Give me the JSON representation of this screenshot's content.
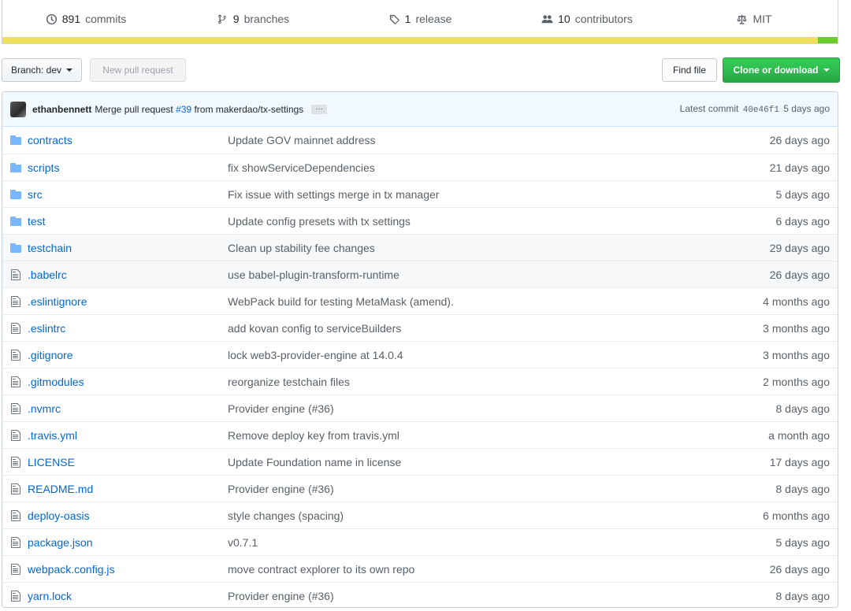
{
  "summary": {
    "commits": {
      "count": "891",
      "label": "commits",
      "icon": "history-icon"
    },
    "branches": {
      "count": "9",
      "label": "branches",
      "icon": "branch-icon"
    },
    "releases": {
      "count": "1",
      "label": "release",
      "icon": "tag-icon"
    },
    "contributors": {
      "count": "10",
      "label": "contributors",
      "icon": "people-icon"
    },
    "license": {
      "label": "MIT",
      "icon": "law-icon"
    },
    "language_colors": {
      "primary": "#f1e05a",
      "secondary": "#6ccc2c"
    }
  },
  "toolbar": {
    "branch_label": "Branch: dev",
    "new_pr_label": "New pull request",
    "find_file_label": "Find file",
    "clone_label": "Clone or download"
  },
  "latest_commit": {
    "author": "ethanbennett",
    "message_prefix": "Merge pull request",
    "pr_link": "#39",
    "message_suffix": "from makerdao/tx-settings",
    "ellipsis": "…",
    "latest_label": "Latest commit",
    "sha": "40e46f1",
    "age": "5 days ago"
  },
  "files": [
    {
      "type": "dir",
      "name": "contracts",
      "message": "Update GOV mainnet address",
      "age": "26 days ago"
    },
    {
      "type": "dir",
      "name": "scripts",
      "message": "fix showServiceDependencies",
      "age": "21 days ago"
    },
    {
      "type": "dir",
      "name": "src",
      "message": "Fix issue with settings merge in tx manager",
      "age": "5 days ago"
    },
    {
      "type": "dir",
      "name": "test",
      "message": "Update config presets with tx settings",
      "age": "6 days ago"
    },
    {
      "type": "dir",
      "name": "testchain",
      "message": "Clean up stability fee changes",
      "age": "29 days ago"
    },
    {
      "type": "file",
      "name": ".babelrc",
      "message": "use babel-plugin-transform-runtime",
      "age": "26 days ago"
    },
    {
      "type": "file",
      "name": ".eslintignore",
      "message": "WebPack build for testing MetaMask (amend).",
      "age": "4 months ago"
    },
    {
      "type": "file",
      "name": ".eslintrc",
      "message": "add kovan config to serviceBuilders",
      "age": "3 months ago"
    },
    {
      "type": "file",
      "name": ".gitignore",
      "message": "lock web3-provider-engine at 14.0.4",
      "age": "3 months ago"
    },
    {
      "type": "file",
      "name": ".gitmodules",
      "message": "reorganize testchain files",
      "age": "2 months ago"
    },
    {
      "type": "file",
      "name": ".nvmrc",
      "message": "Provider engine (#36)",
      "age": "8 days ago"
    },
    {
      "type": "file",
      "name": ".travis.yml",
      "message": "Remove deploy key from travis.yml",
      "age": "a month ago"
    },
    {
      "type": "file",
      "name": "LICENSE",
      "message": "Update Foundation name in license",
      "age": "17 days ago"
    },
    {
      "type": "file",
      "name": "README.md",
      "message": "Provider engine (#36)",
      "age": "8 days ago"
    },
    {
      "type": "file",
      "name": "deploy-oasis",
      "message": "style changes (spacing)",
      "age": "6 months ago"
    },
    {
      "type": "file",
      "name": "package.json",
      "message": "v0.7.1",
      "age": "5 days ago"
    },
    {
      "type": "file",
      "name": "webpack.config.js",
      "message": "move contract explorer to its own repo",
      "age": "26 days ago"
    },
    {
      "type": "file",
      "name": "yarn.lock",
      "message": "Provider engine (#36)",
      "age": "8 days ago"
    }
  ]
}
